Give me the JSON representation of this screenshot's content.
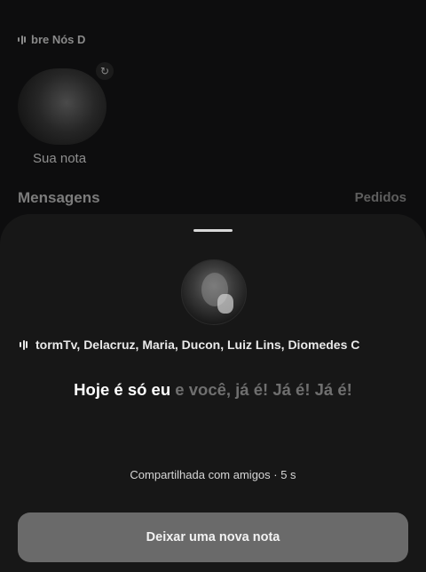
{
  "background": {
    "music_label": "bre Nós D",
    "note_caption": "Sua nota",
    "messages_heading": "Mensagens",
    "requests_label": "Pedidos"
  },
  "sheet": {
    "song_credits": "tormTv, Delacruz, Maria, Ducon, Luiz Lins, Diomedes C",
    "lyrics_active": "Hoje é só eu",
    "lyrics_rest": " e você, já é! Já é! Já é!",
    "shared_status": "Compartilhada com amigos · 5 s",
    "leave_note_button": "Deixar uma nova nota"
  },
  "icons": {
    "music": "music-bars-icon",
    "edit_note": "edit-note-icon"
  }
}
